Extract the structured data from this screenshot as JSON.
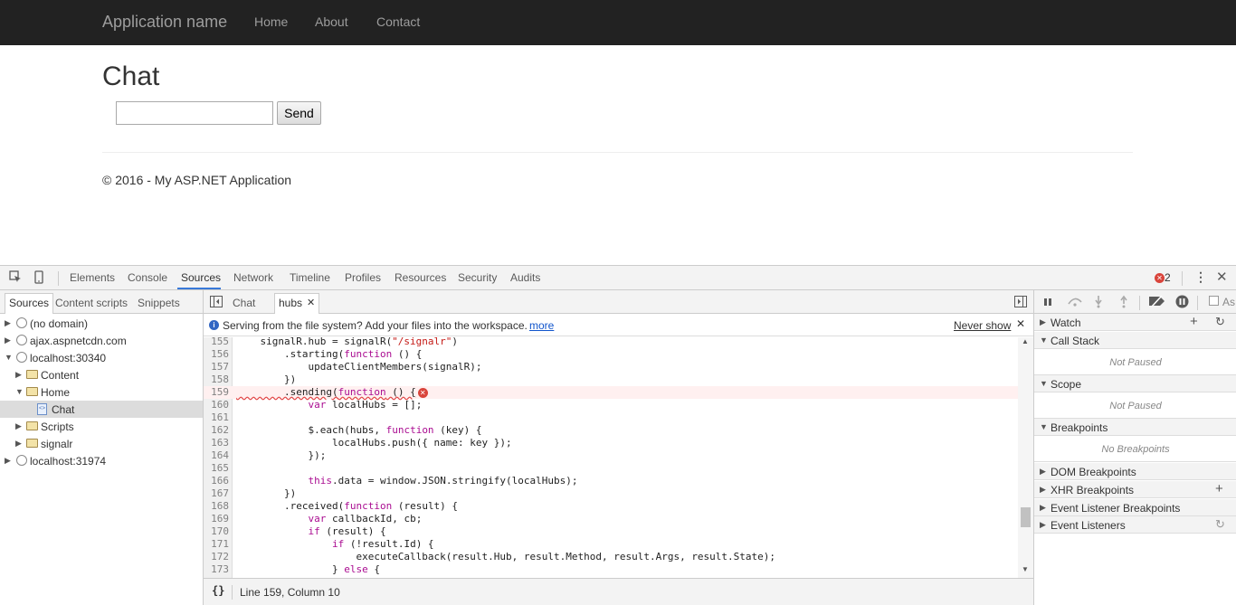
{
  "site": {
    "brand": "Application name",
    "nav": [
      "Home",
      "About",
      "Contact"
    ],
    "heading": "Chat",
    "input_value": "",
    "send_label": "Send",
    "footer": "© 2016 - My ASP.NET Application"
  },
  "devtools": {
    "tabs": [
      "Elements",
      "Console",
      "Sources",
      "Network",
      "Timeline",
      "Profiles",
      "Resources",
      "Security",
      "Audits"
    ],
    "active_tab": "Sources",
    "error_count": "2",
    "navigator_tabs": [
      "Sources",
      "Content scripts",
      "Snippets"
    ],
    "tree": [
      {
        "label": "(no domain)"
      },
      {
        "label": "ajax.aspnetcdn.com"
      },
      {
        "label": "localhost:30340"
      },
      {
        "label": "Content"
      },
      {
        "label": "Home"
      },
      {
        "label": "Chat"
      },
      {
        "label": "Scripts"
      },
      {
        "label": "signalr"
      },
      {
        "label": "localhost:31974"
      }
    ],
    "editor_tabs": [
      "Chat",
      "hubs"
    ],
    "infobar": {
      "message": "Serving from the file system? Add your files into the workspace.",
      "link": "more",
      "dismiss": "Never show"
    },
    "code_lines": [
      {
        "n": "155",
        "text": "    signalR.hub = signalR(\"/signalr\")"
      },
      {
        "n": "156",
        "text": "        .starting(function () {"
      },
      {
        "n": "157",
        "text": "            updateClientMembers(signalR);"
      },
      {
        "n": "158",
        "text": "        })"
      },
      {
        "n": "159",
        "text": "        .sending(function () {"
      },
      {
        "n": "160",
        "text": "            var localHubs = [];"
      },
      {
        "n": "161",
        "text": ""
      },
      {
        "n": "162",
        "text": "            $.each(hubs, function (key) {"
      },
      {
        "n": "163",
        "text": "                localHubs.push({ name: key });"
      },
      {
        "n": "164",
        "text": "            });"
      },
      {
        "n": "165",
        "text": ""
      },
      {
        "n": "166",
        "text": "            this.data = window.JSON.stringify(localHubs);"
      },
      {
        "n": "167",
        "text": "        })"
      },
      {
        "n": "168",
        "text": "        .received(function (result) {"
      },
      {
        "n": "169",
        "text": "            var callbackId, cb;"
      },
      {
        "n": "170",
        "text": "            if (result) {"
      },
      {
        "n": "171",
        "text": "                if (!result.Id) {"
      },
      {
        "n": "172",
        "text": "                    executeCallback(result.Hub, result.Method, result.Args, result.State);"
      },
      {
        "n": "173",
        "text": "                } else {"
      }
    ],
    "status": "Line 159, Column 10",
    "pretty_print": "{}",
    "sidebar": {
      "async_label": "As",
      "sections": [
        {
          "title": "Watch",
          "body": ""
        },
        {
          "title": "Call Stack",
          "body": "Not Paused"
        },
        {
          "title": "Scope",
          "body": "Not Paused"
        },
        {
          "title": "Breakpoints",
          "body": "No Breakpoints"
        },
        {
          "title": "DOM Breakpoints",
          "body": ""
        },
        {
          "title": "XHR Breakpoints",
          "body": ""
        },
        {
          "title": "Event Listener Breakpoints",
          "body": ""
        },
        {
          "title": "Event Listeners",
          "body": ""
        }
      ]
    }
  }
}
